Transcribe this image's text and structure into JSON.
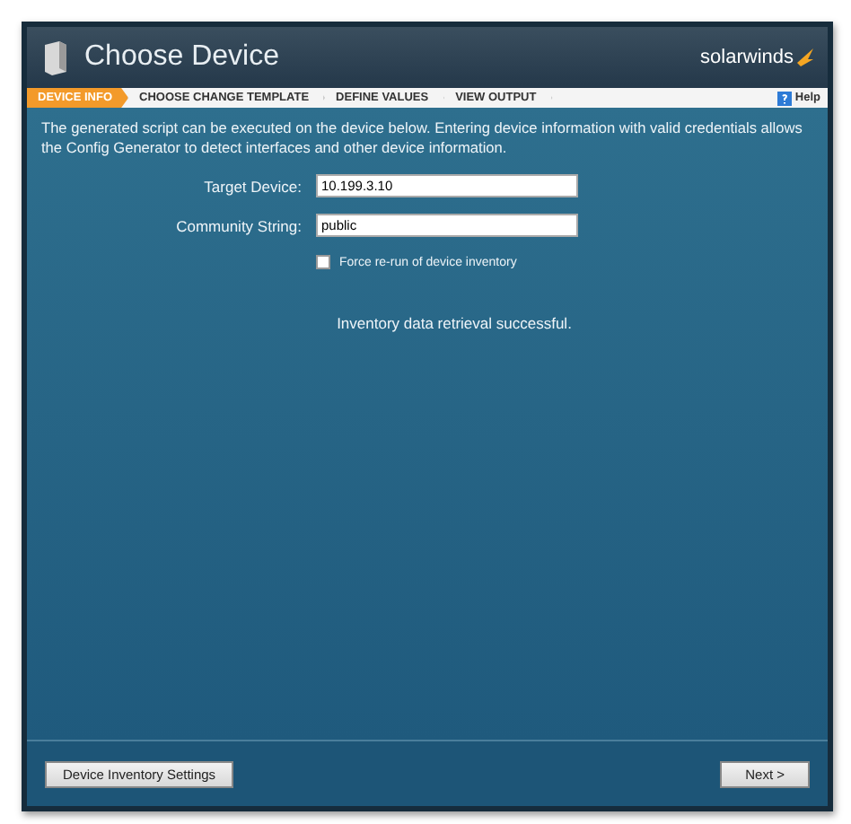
{
  "window": {
    "title": "Choose Device",
    "brand": "solarwinds"
  },
  "steps": [
    {
      "label": "DEVICE INFO",
      "selected": true
    },
    {
      "label": "CHOOSE CHANGE TEMPLATE",
      "selected": false
    },
    {
      "label": "DEFINE VALUES",
      "selected": false
    },
    {
      "label": "VIEW OUTPUT",
      "selected": false
    }
  ],
  "help": {
    "label": "Help"
  },
  "intro": "The generated script can be executed on the device below. Entering device information with valid credentials allows the Config Generator to detect interfaces and other device information.",
  "fields": [
    {
      "label": "Target Device:",
      "value": "10.199.3.10"
    },
    {
      "label": "Community String:",
      "value": "public"
    }
  ],
  "force_rerun": {
    "label": "Force re-run of device inventory",
    "checked": false
  },
  "status": "Inventory data retrieval successful.",
  "buttons": [
    {
      "label": "Device Inventory Settings"
    },
    {
      "label": "Next >"
    }
  ]
}
